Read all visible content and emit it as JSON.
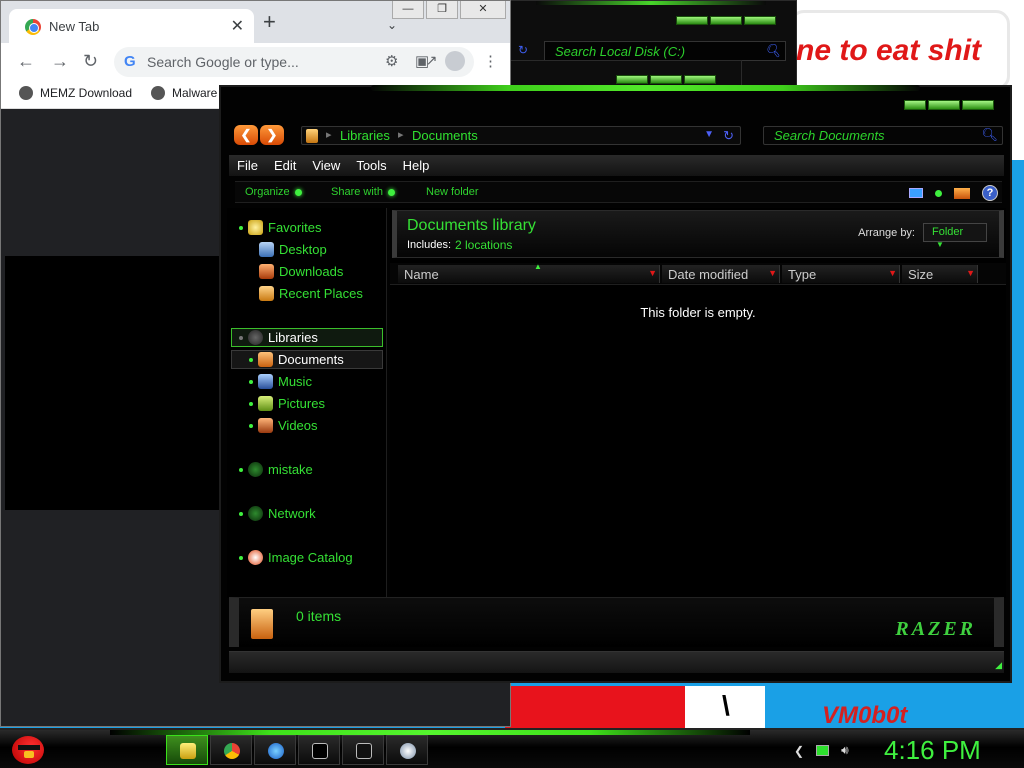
{
  "wallpaper": {
    "meme_text": "ne to eat shit",
    "signature": "VM0b0t"
  },
  "back_window": {
    "search_placeholder": "Search Local Disk (C:)"
  },
  "chrome": {
    "tab_title": "New Tab",
    "new_tab_symbol": "+",
    "omnibox_placeholder": "Search Google or type...",
    "bookmarks": [
      "MEMZ Download",
      "Malware"
    ]
  },
  "explorer": {
    "breadcrumb": [
      "Libraries",
      "Documents"
    ],
    "search_placeholder": "Search Documents",
    "menu": [
      "File",
      "Edit",
      "View",
      "Tools",
      "Help"
    ],
    "commands": [
      "Organize",
      "Share with",
      "New folder"
    ],
    "nav": {
      "favorites": {
        "label": "Favorites",
        "items": [
          "Desktop",
          "Downloads",
          "Recent Places"
        ]
      },
      "libraries": {
        "label": "Libraries",
        "items": [
          "Documents",
          "Music",
          "Pictures",
          "Videos"
        ]
      },
      "others": [
        "mistake",
        "Network",
        "Image Catalog"
      ]
    },
    "library": {
      "title": "Documents library",
      "includes_label": "Includes:",
      "includes_value": "2 locations",
      "arrange_label": "Arrange by:",
      "arrange_value": "Folder"
    },
    "columns": [
      "Name",
      "Date modified",
      "Type",
      "Size"
    ],
    "empty_message": "This folder is empty.",
    "details": {
      "count": "0 items",
      "brand": "RAZER"
    }
  },
  "taskbar": {
    "clock": "4:16 PM"
  },
  "colors": {
    "accent_green": "#35e035",
    "explorer_bg": "#020202",
    "desktop_blue": "#1aa0e6"
  }
}
